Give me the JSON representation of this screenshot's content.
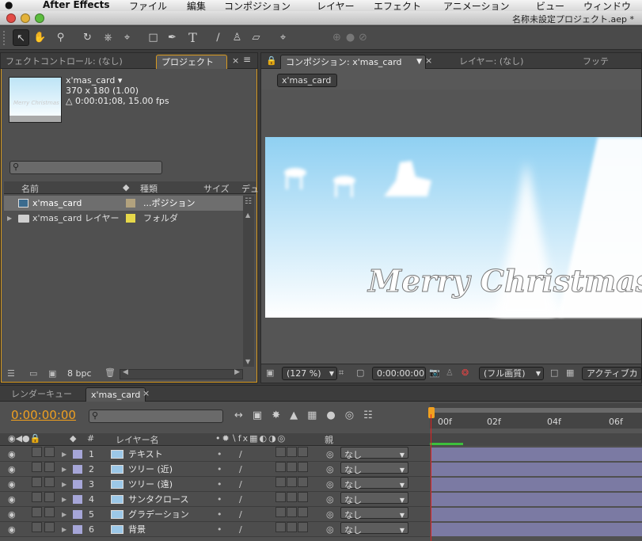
{
  "menubar": {
    "app": "After Effects",
    "items": [
      "ファイル",
      "編集",
      "コンポジション",
      "レイヤー",
      "エフェクト",
      "アニメーション",
      "ビュー",
      "ウィンドウ"
    ]
  },
  "window": {
    "title": "名称未設定プロジェクト.aep *"
  },
  "project_panel": {
    "tabs": [
      "フェクトコントロール: (なし)",
      "プロジェクト"
    ],
    "item_name": "x'mas_card ▾",
    "item_size": "370 x 180 (1.00)",
    "item_duration": "△ 0:00:01;08, 15.00 fps",
    "thumb_text": "Merry Christmas",
    "columns": [
      "名前",
      "種類",
      "サイズ",
      "デュ"
    ],
    "items": [
      {
        "name": "x'mas_card",
        "type": "...ポジション",
        "color": "#b2a27e"
      },
      {
        "name": "x'mas_card レイヤー",
        "type": "フォルダ",
        "color": "#e6d84a"
      }
    ],
    "bpc": "8 bpc"
  },
  "comp_panel": {
    "tabs": [
      "コンポジション: x'mas_card",
      "レイヤー: (なし)",
      "フッテ"
    ],
    "comp_button": "x'mas_card",
    "card_text": "Merry Christmas",
    "zoom": "(127 %)",
    "timecode": "0:00:00:00",
    "resolution": "(フル画質)",
    "active_camera": "アクティブカ"
  },
  "timeline": {
    "tabs": [
      "レンダーキュー",
      "x'mas_card"
    ],
    "timecode": "0:00:00:00",
    "columns": [
      "レイヤー名",
      "親"
    ],
    "ruler": [
      "00f",
      "02f",
      "04f",
      "06f"
    ],
    "layers": [
      {
        "num": "1",
        "name": "テキスト",
        "parent": "なし"
      },
      {
        "num": "2",
        "name": "ツリー (近)",
        "parent": "なし"
      },
      {
        "num": "3",
        "name": "ツリー (遠)",
        "parent": "なし"
      },
      {
        "num": "4",
        "name": "サンタクロース",
        "parent": "なし"
      },
      {
        "num": "5",
        "name": "グラデーション",
        "parent": "なし"
      },
      {
        "num": "6",
        "name": "背景",
        "parent": "なし"
      }
    ]
  },
  "colors": {
    "accent": "#f0a020",
    "layer_bar": "#7b7aa3",
    "label": "#a6a6d8"
  },
  "icons": [
    "apple-icon",
    "selection-tool-icon",
    "hand-tool-icon",
    "zoom-tool-icon",
    "rotate-tool-icon",
    "camera-tool-icon",
    "pan-behind-icon",
    "rectangle-tool-icon",
    "pen-tool-icon",
    "text-tool-icon",
    "brush-tool-icon",
    "clone-stamp-icon",
    "eraser-icon",
    "puppet-pin-icon",
    "search-icon",
    "trash-icon",
    "folder-icon",
    "eye-icon",
    "speaker-icon",
    "lock-icon",
    "label-icon",
    "twirl-arrow-icon",
    "footage-icon",
    "pickwhip-icon",
    "camera-icon",
    "color-channels-icon",
    "playhead-icon"
  ]
}
